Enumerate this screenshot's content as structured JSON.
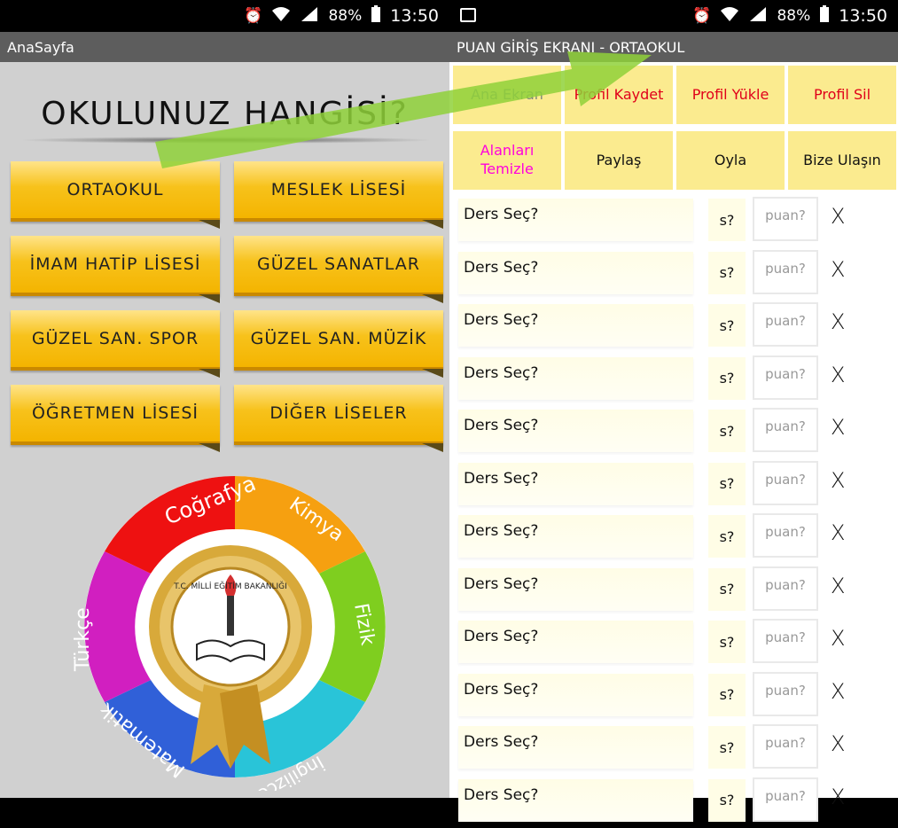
{
  "status_bar": {
    "battery": "88%",
    "time": "13:50"
  },
  "left": {
    "title": "AnaSayfa",
    "question": "OKULUNUZ HANGİSİ?",
    "buttons": [
      "ORTAOKUL",
      "MESLEK LİSESİ",
      "İMAM HATİP LİSESİ",
      "GÜZEL SANATLAR",
      "GÜZEL SAN. SPOR",
      "GÜZEL SAN. MÜZİK",
      "ÖĞRETMEN LİSESİ",
      "DİĞER LİSELER"
    ],
    "emblem": {
      "segments": [
        "Coğrafya",
        "Kimya",
        "Fizik",
        "İngilizce",
        "Matematik",
        "Türkçe"
      ],
      "seal_text": "T.C. MİLLİ EĞİTİM BAKANLIĞI",
      "colors": [
        "#ee1111",
        "#f6a010",
        "#7fce1f",
        "#29c4d8",
        "#3060d8",
        "#d11fc0"
      ]
    }
  },
  "right": {
    "title": "PUAN GİRİŞ EKRANI - ORTAOKUL",
    "menu": [
      {
        "label": "Ana Ekran",
        "color": "grey"
      },
      {
        "label": "Profil Kaydet",
        "color": "red"
      },
      {
        "label": "Profil Yükle",
        "color": "red"
      },
      {
        "label": "Profil Sil",
        "color": "red"
      },
      {
        "label": "Alanları Temizle",
        "color": "magenta"
      },
      {
        "label": "Paylaş",
        "color": "black"
      },
      {
        "label": "Oyla",
        "color": "black"
      },
      {
        "label": "Bize Ulaşın",
        "color": "black"
      }
    ],
    "rows": [
      {
        "ders": "Ders Seç?",
        "s": "s?",
        "puan": "puan?",
        "remove": "X"
      },
      {
        "ders": "Ders Seç?",
        "s": "s?",
        "puan": "puan?",
        "remove": "X"
      },
      {
        "ders": "Ders Seç?",
        "s": "s?",
        "puan": "puan?",
        "remove": "X"
      },
      {
        "ders": "Ders Seç?",
        "s": "s?",
        "puan": "puan?",
        "remove": "X"
      },
      {
        "ders": "Ders Seç?",
        "s": "s?",
        "puan": "puan?",
        "remove": "X"
      },
      {
        "ders": "Ders Seç?",
        "s": "s?",
        "puan": "puan?",
        "remove": "X"
      },
      {
        "ders": "Ders Seç?",
        "s": "s?",
        "puan": "puan?",
        "remove": "X"
      },
      {
        "ders": "Ders Seç?",
        "s": "s?",
        "puan": "puan?",
        "remove": "X"
      },
      {
        "ders": "Ders Seç?",
        "s": "s?",
        "puan": "puan?",
        "remove": "X"
      },
      {
        "ders": "Ders Seç?",
        "s": "s?",
        "puan": "puan?",
        "remove": "X"
      },
      {
        "ders": "Ders Seç?",
        "s": "s?",
        "puan": "puan?",
        "remove": "X"
      },
      {
        "ders": "Ders Seç?",
        "s": "s?",
        "puan": "puan?",
        "remove": "X"
      }
    ]
  }
}
